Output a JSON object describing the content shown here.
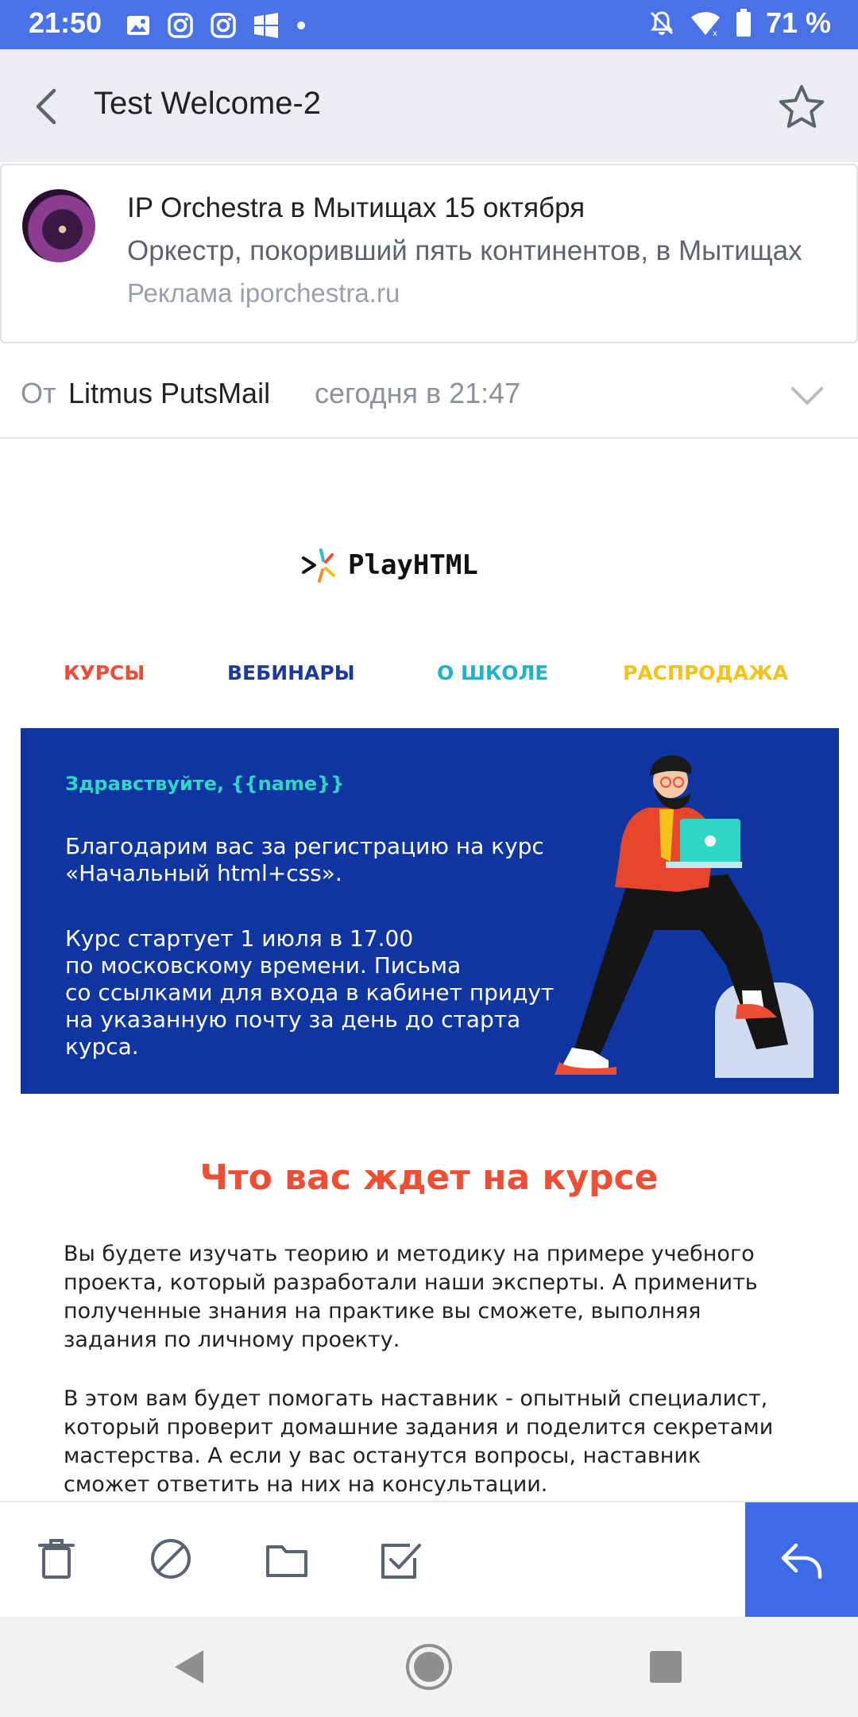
{
  "status_bar": {
    "time": "21:50",
    "battery": "71 %",
    "icons": [
      "image-icon",
      "instagram-icon",
      "instagram-icon",
      "windows-icon",
      "dot-icon",
      "mute-icon",
      "wifi-icon",
      "battery-icon"
    ]
  },
  "app_bar": {
    "title": "Test Welcome-2"
  },
  "ad": {
    "title": "IP Orchestra в Мытищах 15 октября",
    "description": "Оркестр, покоривший пять континентов, в Мытищах",
    "source": "Реклама iporchestra.ru"
  },
  "from_row": {
    "label": "От",
    "sender": "Litmus PutsMail",
    "date": "сегодня в 21:47"
  },
  "email": {
    "brand": "PlayHTML",
    "nav": [
      {
        "label": "КУРСЫ",
        "color": "#f04d35"
      },
      {
        "label": "ВЕБИНАРЫ",
        "color": "#1a3a9c"
      },
      {
        "label": "О ШКОЛЕ",
        "color": "#1fb3c8"
      },
      {
        "label": "РАСПРОДАЖА",
        "color": "#f5c21b"
      }
    ],
    "hero": {
      "greeting": "Здравствуйте, {{name}}",
      "p1": "Благодарим вас за регистрацию на курс\n«Начальный html+css».",
      "p2": "Курс стартует 1 июля в 17.00\nпо московскому времени. Письма\nсо ссылками для входа в кабинет придут\nна указанную почту за день до старта\nкурса."
    },
    "section_title": "Что вас ждет на курсе",
    "body_p1": "Вы будете изучать теорию и методику на примере учебного\nпроекта, который разработали наши эксперты. А применить\nполученные знания на практике вы сможете, выполняя\nзадания по личному проекту.",
    "body_p2": "В этом вам будет помогать наставник - опытный специалист,\nкоторый проверит домашние задания и поделится секретами\nмастерства. А если у вас останутся вопросы, наставник\nсможет ответить на них на консультации."
  },
  "toolbar": {
    "icons": [
      "trash-icon",
      "spam-icon",
      "folder-icon",
      "mark-read-icon",
      "reply-icon"
    ]
  },
  "colors": {
    "status_bar": "#4a72e8",
    "hero_bg": "#0f36a0",
    "accent_red": "#f04d35",
    "reply_button": "#3e6be8"
  }
}
